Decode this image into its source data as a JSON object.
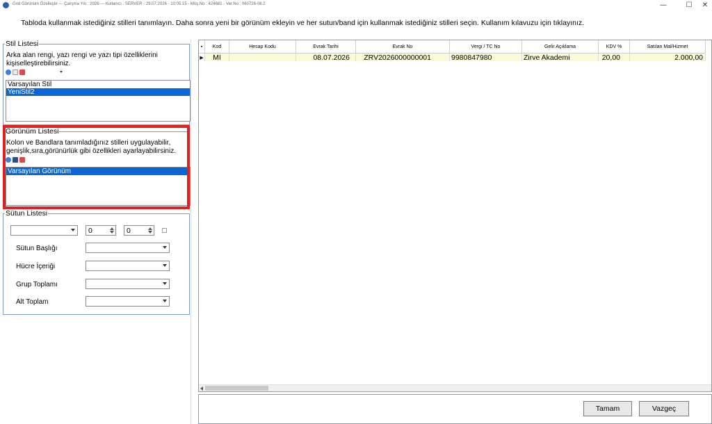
{
  "window": {
    "title": "Grid Görünüm Özelleştir  ---  Çalışma Yılı : 2026  ---  Kullanıcı : SERVER - 29.07.2026 - 10:05:15 - Müş.No : 424681 - Ver.No : 060726-06.2",
    "minimize": "—",
    "maximize": "☐",
    "close": "✕"
  },
  "instruction": "Tabloda kullanmak istediğiniz stilleri tanımlayın. Daha sonra  yeni bir görünüm ekleyin ve her sutun/band için kullanmak istediğiniz stilleri seçin. Kullanım kılavuzu için tıklayınız.",
  "style_list": {
    "title": "Stil Listesi",
    "desc_line1": "Arka alan rengi, yazı rengi ve yazı tipi özelliklerini",
    "desc_line2": "kişiselleştirebilirsiniz.",
    "items": [
      "Varsayılan Stil",
      "YeniStil2"
    ]
  },
  "view_list": {
    "title": "Görünüm Listesi",
    "desc_line1": "Kolon ve Bandlara tanımladığınız stilleri uygulayabilir,",
    "desc_line2": "genişlik,sıra,görünürlük gibi özellikleri ayarlayabilirsiniz.",
    "items": [
      "Varsayılan Görünüm"
    ]
  },
  "column_list": {
    "title": "Sütun Listesi",
    "spin1": "0",
    "spin2": "0",
    "labels": {
      "header": "Sütun Başlığı",
      "cell": "Hücre İçeriği",
      "group_total": "Grup Toplamı",
      "sub_total": "Alt Toplam"
    }
  },
  "grid": {
    "columns": [
      "Kod",
      "Hesap Kodu",
      "Evrak Tarihi",
      "Evrak No",
      "Vergi / TC No",
      "Gelir Açıklama",
      "KDV %",
      "Satılan Mal/Hizmet"
    ],
    "row": {
      "indicator": "▸",
      "kod": "MI",
      "hesap_kodu": "",
      "evrak_tarihi": "08.07.2026",
      "evrak_no": "ZRV2026000000001",
      "vergi_no": "9980847980",
      "gelir_aciklama": "Zirve Akademi",
      "kdv": "20,00",
      "satilan": "2.000,00"
    }
  },
  "buttons": {
    "ok": "Tamam",
    "cancel": "Vazgeç"
  },
  "colors": {
    "accent": "#0a66d6",
    "highlight_border": "#e02020",
    "row_bg": "#fbfbd8"
  }
}
